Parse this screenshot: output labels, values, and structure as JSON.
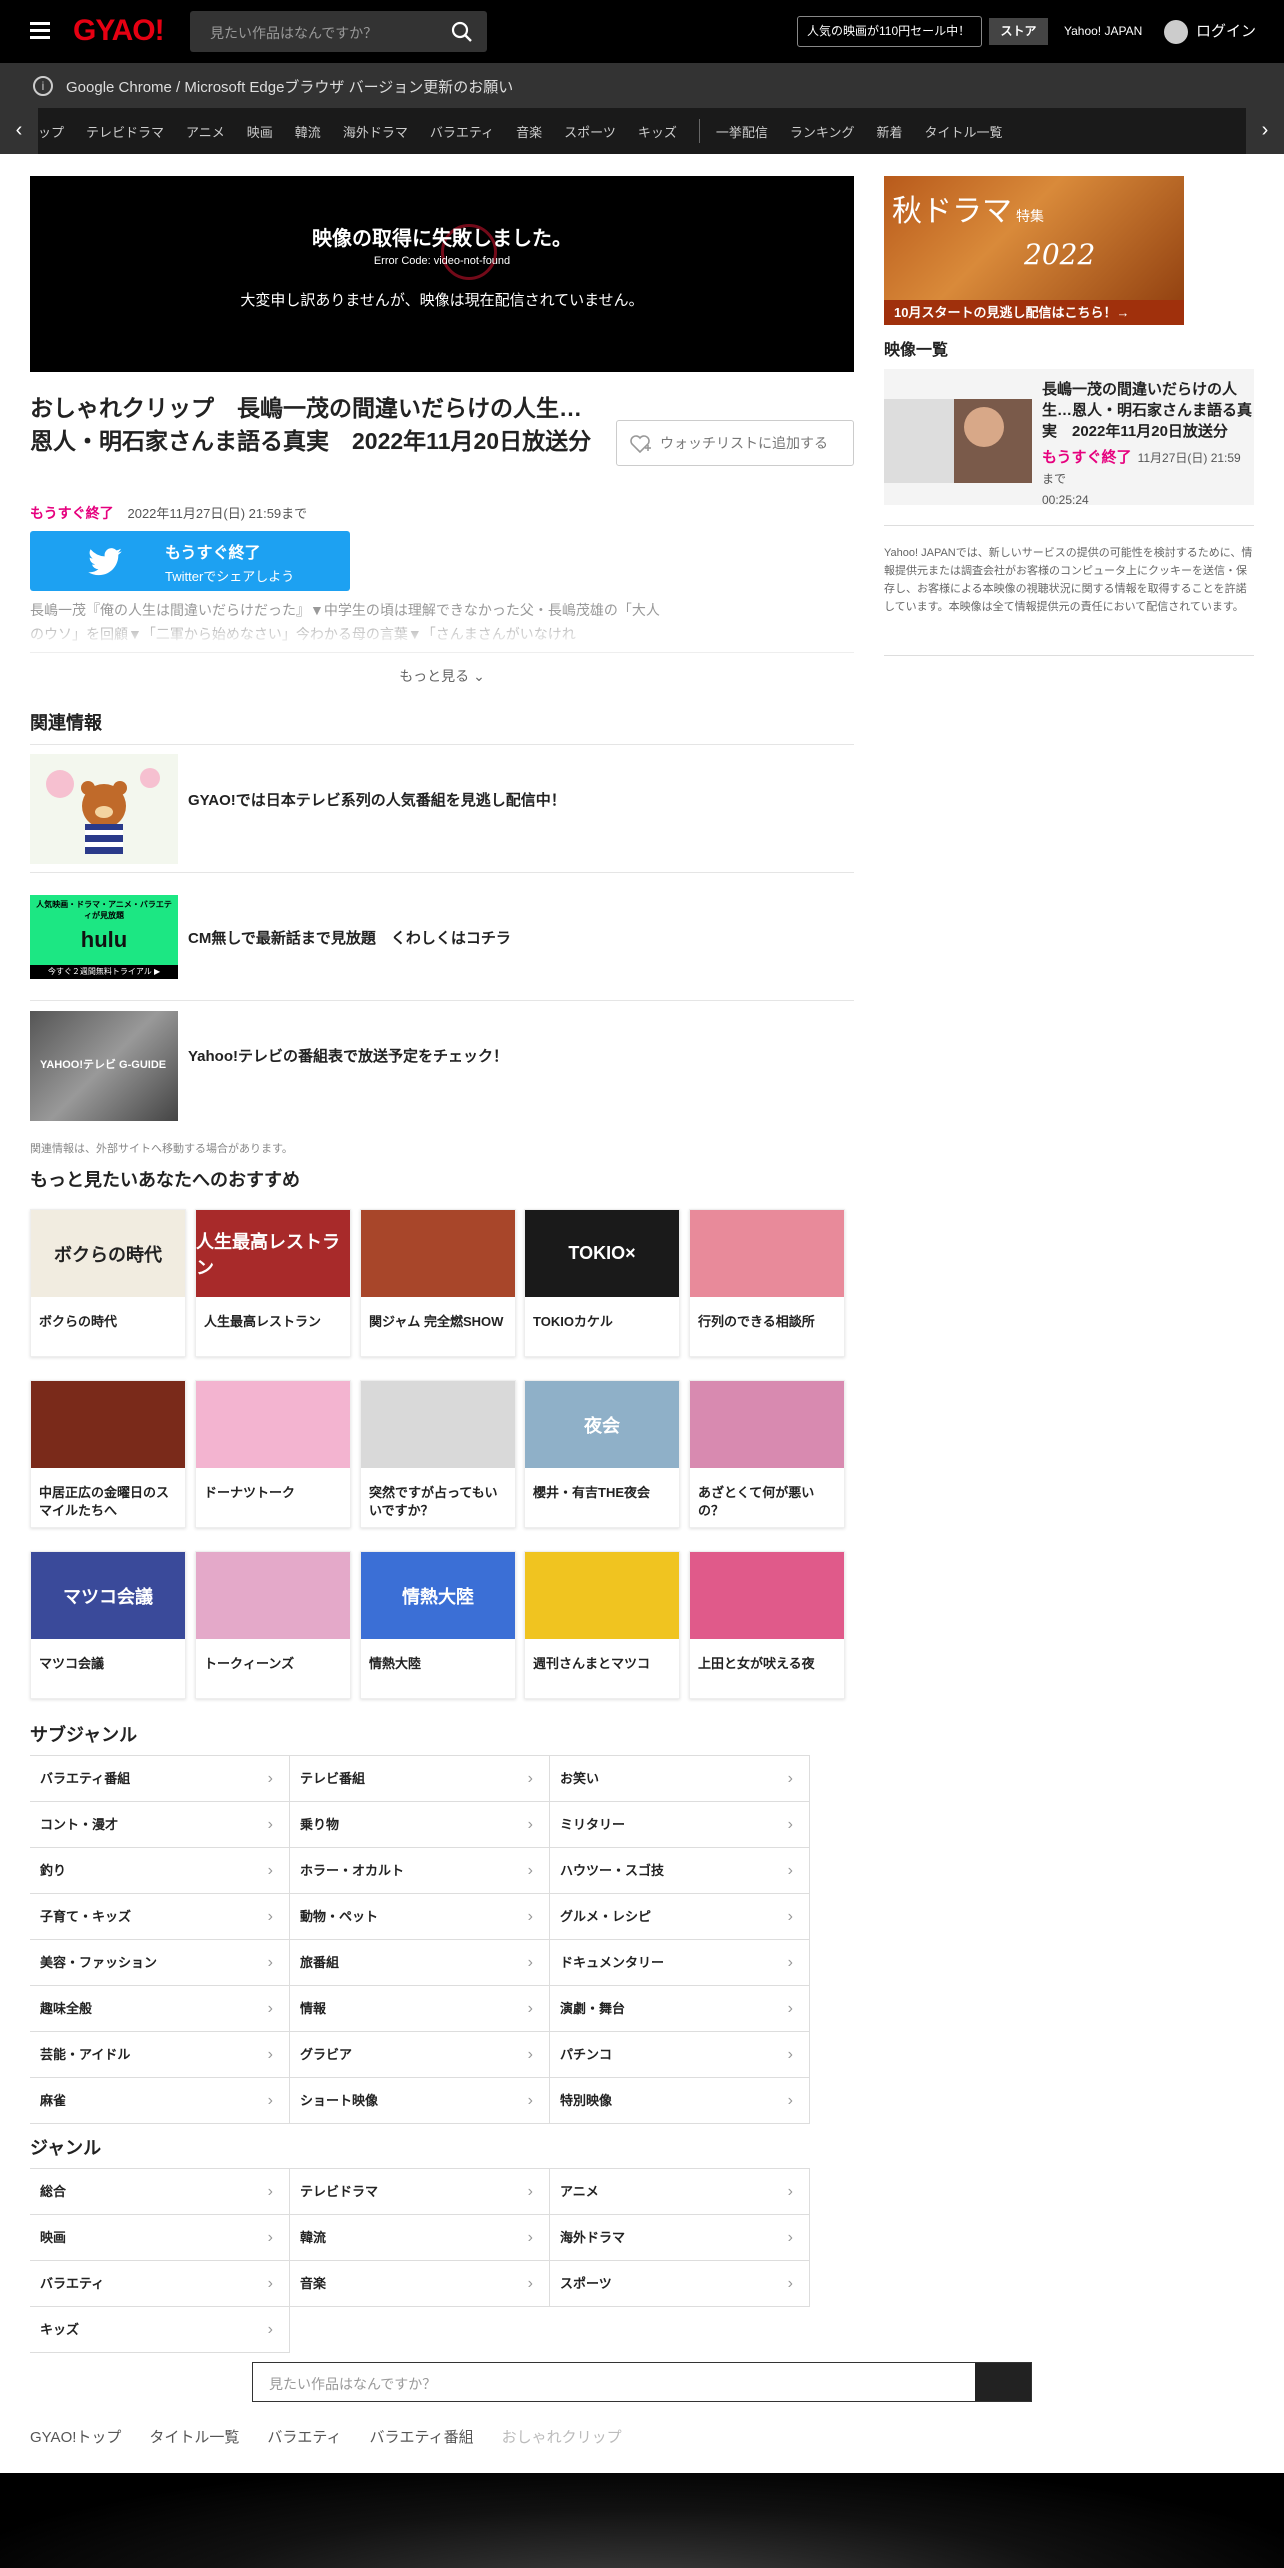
{
  "header": {
    "logo": "GYAO!",
    "search_placeholder": "見たい作品はなんですか？",
    "sale_label": "人気の映画が110円セール中！",
    "store_label": "ストア",
    "yahoo_label": "Yahoo! JAPAN",
    "login_label": "ログイン"
  },
  "notice": {
    "text": "Google Chrome / Microsoft Edgeブラウザ バージョン更新のお願い"
  },
  "nav": {
    "items": [
      "ップ",
      "テレビドラマ",
      "アニメ",
      "映画",
      "韓流",
      "海外ドラマ",
      "バラエティ",
      "音楽",
      "スポーツ",
      "キッズ"
    ],
    "items2": [
      "一挙配信",
      "ランキング",
      "新着",
      "タイトル一覧"
    ]
  },
  "player": {
    "error_title": "映像の取得に失敗しました。",
    "error_code": "Error Code: video-not-found",
    "error_message": "大変申し訳ありませんが、映像は現在配信されていません。"
  },
  "video": {
    "title": "おしゃれクリップ　長嶋一茂の間違いだらけの人生…恩人・明石家さんま語る真実　2022年11月20日放送分",
    "status": "もうすぐ終了",
    "deadline": "2022年11月27日(日) 21:59まで",
    "watchlist_label": "ウォッチリストに追加する",
    "description": "長嶋一茂『俺の人生は間違いだらけだった』▼中学生の頃は理解できなかった父・長嶋茂雄の「大人のウソ」を回顧▼「二軍から始めなさい」今わかる母の言葉▼「さんまさんがいなけれ",
    "more_label": "もっと見る"
  },
  "twitter": {
    "title": "もうすぐ終了",
    "sub": "Twitterでシェアしよう"
  },
  "related": {
    "heading": "関連情報",
    "items": [
      {
        "text": "GYAO!では日本テレビ系列の人気番組を見逃し配信中！"
      },
      {
        "text": "CM無しで最新話まで見放題　くわしくはコチラ",
        "thumb_title": "人気映画・ドラマ・アニメ・バラエティが見放題",
        "thumb_logo": "hulu",
        "thumb_sub": "今すぐ２週間無料トライアル ▶"
      },
      {
        "text": "Yahoo!テレビの番組表で放送予定をチェック！",
        "thumb_logo": "YAHOO!テレビ G-GUIDE"
      }
    ],
    "note": "関連情報は、外部サイトへ移動する場合があります。"
  },
  "recommend": {
    "heading": "もっと見たいあなたへのおすすめ",
    "items": [
      {
        "label": "ボクらの時代",
        "img_text": "ボクらの時代"
      },
      {
        "label": "人生最高レストラン",
        "img_text": "人生最高レストラン"
      },
      {
        "label": "関ジャム 完全燃SHOW",
        "img_text": ""
      },
      {
        "label": "TOKIOカケル",
        "img_text": "TOKIO×"
      },
      {
        "label": "行列のできる相談所",
        "img_text": ""
      },
      {
        "label": "中居正広の金曜日のスマイルたちへ",
        "img_text": ""
      },
      {
        "label": "ドーナツトーク",
        "img_text": ""
      },
      {
        "label": "突然ですが占ってもいいですか？",
        "img_text": ""
      },
      {
        "label": "櫻井・有吉THE夜会",
        "img_text": "夜会"
      },
      {
        "label": "あざとくて何が悪いの？",
        "img_text": ""
      },
      {
        "label": "マツコ会議",
        "img_text": "マツコ会議"
      },
      {
        "label": "トークィーンズ",
        "img_text": ""
      },
      {
        "label": "情熱大陸",
        "img_text": "情熱大陸"
      },
      {
        "label": "週刊さんまとマツコ",
        "img_text": ""
      },
      {
        "label": "上田と女が吠える夜",
        "img_text": ""
      }
    ],
    "colors": [
      "#f1ece0",
      "#a82a2a",
      "#a8462a",
      "#1a1a1a",
      "#e88a9a",
      "#7a2a1a",
      "#f3b4d0",
      "#d9d9d9",
      "#8fb0c8",
      "#d88ab0",
      "#3a4a9a",
      "#e4a9c9",
      "#3b6fd6",
      "#f0c420",
      "#e05a8a"
    ]
  },
  "subgenre": {
    "heading": "サブジャンル",
    "items": [
      "バラエティ番組",
      "テレビ番組",
      "お笑い",
      "コント・漫才",
      "乗り物",
      "ミリタリー",
      "釣り",
      "ホラー・オカルト",
      "ハウツー・スゴ技",
      "子育て・キッズ",
      "動物・ペット",
      "グルメ・レシピ",
      "美容・ファッション",
      "旅番組",
      "ドキュメンタリー",
      "趣味全般",
      "情報",
      "演劇・舞台",
      "芸能・アイドル",
      "グラビア",
      "パチンコ",
      "麻雀",
      "ショート映像",
      "特別映像"
    ]
  },
  "genre": {
    "heading": "ジャンル",
    "items": [
      "総合",
      "テレビドラマ",
      "アニメ",
      "映画",
      "韓流",
      "海外ドラマ",
      "バラエティ",
      "音楽",
      "スポーツ",
      "キッズ"
    ]
  },
  "bottom_search": {
    "placeholder": "見たい作品はなんですか？"
  },
  "breadcrumb": [
    "GYAO!トップ",
    "タイトル一覧",
    "バラエティ",
    "バラエティ番組",
    "おしゃれクリップ"
  ],
  "side": {
    "banner_title": "秋ドラマ",
    "banner_tag": "特集",
    "banner_year": "2022",
    "banner_cta": "10月スタートの見逃し配信はこちら！→",
    "heading": "映像一覧",
    "item": {
      "title": "長嶋一茂の間違いだらけの人生…恩人・明石家さんま語る真実　2022年11月20日放送分",
      "status": "もうすぐ終了",
      "deadline": "11月27日(日) 21:59まで",
      "duration": "00:25:24"
    },
    "note": "Yahoo! JAPANでは、新しいサービスの提供の可能性を検討するために、情報提供元または調査会社がお客様のコンピュータ上にクッキーを送信・保存し、お客様による本映像の視聴状況に関する情報を取得することを許諾しています。本映像は全て情報提供元の責任において配信されています。"
  }
}
